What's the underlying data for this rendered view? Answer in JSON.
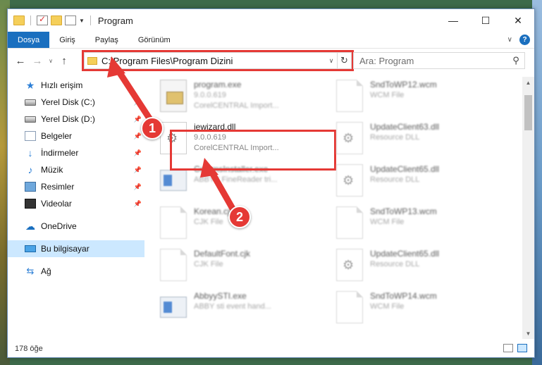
{
  "window": {
    "title": "Program",
    "controls": {
      "minimize": "—",
      "maximize": "☐",
      "close": "✕"
    }
  },
  "ribbon": {
    "tabs": [
      {
        "label": "Dosya",
        "active": true
      },
      {
        "label": "Giriş"
      },
      {
        "label": "Paylaş"
      },
      {
        "label": "Görünüm"
      }
    ],
    "help": "?",
    "expand": "∨"
  },
  "navigation": {
    "back": "←",
    "forward": "→",
    "recent": "∨",
    "up": "↑",
    "address": "C:\\Program Files\\Program Dizini",
    "address_dropdown": "∨",
    "refresh": "↻",
    "search_placeholder": "Ara: Program",
    "search_icon": "⚲"
  },
  "sidebar": {
    "items": [
      {
        "label": "Hızlı erişim",
        "icon": "star-icon",
        "glyph": "★"
      },
      {
        "label": "Yerel Disk (C:)",
        "icon": "disk-icon",
        "pinned": true
      },
      {
        "label": "Yerel Disk (D:)",
        "icon": "disk-icon",
        "pinned": true
      },
      {
        "label": "Belgeler",
        "icon": "documents-icon",
        "pinned": true
      },
      {
        "label": "İndirmeler",
        "icon": "download-icon",
        "glyph": "↓",
        "pinned": true
      },
      {
        "label": "Müzik",
        "icon": "music-icon",
        "glyph": "♪",
        "pinned": true
      },
      {
        "label": "Resimler",
        "icon": "pictures-icon",
        "pinned": true
      },
      {
        "label": "Videolar",
        "icon": "videos-icon",
        "pinned": true
      },
      {
        "label": "OneDrive",
        "icon": "cloud-icon",
        "glyph": "☁"
      },
      {
        "label": "Bu bilgisayar",
        "icon": "pc-icon",
        "selected": true
      },
      {
        "label": "Ağ",
        "icon": "network-icon",
        "glyph": "⇆"
      }
    ],
    "pin_glyph": "📌"
  },
  "files": {
    "left": [
      {
        "name": "program.exe",
        "line2": "9.0.0.619",
        "line3": "CorelCENTRAL Import...",
        "icon": "setup-icon",
        "blurred": true
      },
      {
        "name": "iewizard.dll",
        "line2": "9.0.0.619",
        "line3": "CorelCENTRAL Import...",
        "icon": "dll-icon",
        "blurred": false,
        "highlighted": true
      },
      {
        "name": "CommsInstaller.exe",
        "line2": "ABBYY FineReader tri...",
        "line3": "",
        "icon": "exe-icon",
        "blurred": true
      },
      {
        "name": "Korean.cjk",
        "line2": "CJK File",
        "line3": "",
        "icon": "page-icon",
        "blurred": true
      },
      {
        "name": "DefaultFont.cjk",
        "line2": "CJK File",
        "line3": "",
        "icon": "page-icon",
        "blurred": true
      },
      {
        "name": "AbbyySTI.exe",
        "line2": "ABBY sti event hand...",
        "line3": "",
        "icon": "exe-icon",
        "blurred": true
      }
    ],
    "right": [
      {
        "name": "SndToWP12.wcm",
        "line2": "WCM File",
        "icon": "page-icon"
      },
      {
        "name": "UpdateClient63.dll",
        "line2": "Resource DLL",
        "icon": "dll-icon"
      },
      {
        "name": "UpdateClient65.dll",
        "line2": "Resource DLL",
        "icon": "dll-icon"
      },
      {
        "name": "SndToWP13.wcm",
        "line2": "WCM File",
        "icon": "page-icon"
      },
      {
        "name": "UpdateClient65.dll",
        "line2": "Resource DLL",
        "icon": "dll-icon"
      },
      {
        "name": "SndToWP14.wcm",
        "line2": "WCM File",
        "icon": "page-icon"
      }
    ]
  },
  "status": {
    "item_count": "178 öğe"
  },
  "callouts": [
    {
      "number": "1"
    },
    {
      "number": "2"
    }
  ],
  "colors": {
    "accent": "#1a6fbf",
    "highlight": "#e53935",
    "selection": "#cce8ff"
  }
}
